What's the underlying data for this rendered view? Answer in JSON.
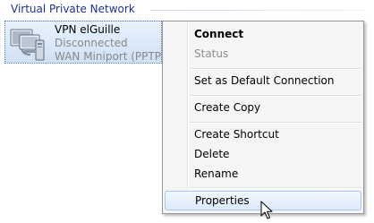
{
  "group": {
    "header": "Virtual Private Network"
  },
  "connection": {
    "name": "VPN elGuille",
    "status": "Disconnected",
    "device": "WAN Miniport (PPTP)",
    "icon": "vpn-connection-icon"
  },
  "context_menu": {
    "items": [
      {
        "label": "Connect",
        "style": "bold"
      },
      {
        "label": "Status",
        "style": "disabled"
      },
      {
        "label": "Set as Default Connection",
        "style": "normal"
      },
      {
        "label": "Create Copy",
        "style": "normal"
      },
      {
        "label": "Create Shortcut",
        "style": "normal"
      },
      {
        "label": "Delete",
        "style": "normal"
      },
      {
        "label": "Rename",
        "style": "normal"
      },
      {
        "label": "Properties",
        "style": "highlighted"
      }
    ]
  },
  "colors": {
    "header_text": "#1e3287",
    "selection_bg": "#cfe1f6",
    "highlight_border": "#a8c7ec",
    "disabled_text": "#8d8d8d"
  },
  "cursor": {
    "icon": "arrow-cursor-icon"
  }
}
